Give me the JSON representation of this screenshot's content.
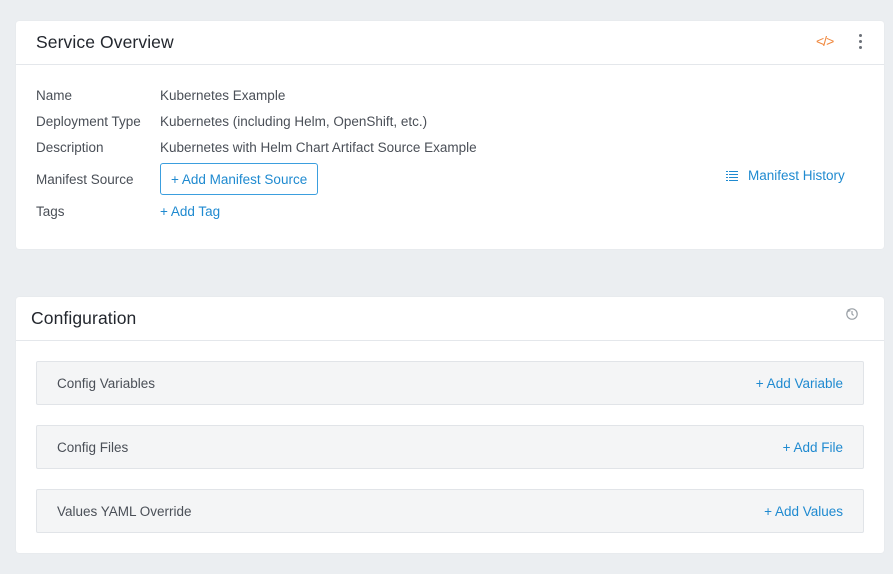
{
  "overview": {
    "title": "Service Overview",
    "code_icon": "</>",
    "rows": [
      {
        "label": "Name",
        "value": "Kubernetes Example"
      },
      {
        "label": "Deployment Type",
        "value": "Kubernetes (including Helm, OpenShift, etc.)"
      },
      {
        "label": "Description",
        "value": "Kubernetes with Helm Chart Artifact Source Example"
      },
      {
        "label": "Manifest Source",
        "button": "+ Add Manifest Source"
      },
      {
        "label": "Tags",
        "link": "+ Add Tag"
      }
    ],
    "manifest_history": "Manifest History"
  },
  "configuration": {
    "title": "Configuration",
    "sections": [
      {
        "title": "Config Variables",
        "action": "+ Add Variable"
      },
      {
        "title": "Config Files",
        "action": "+ Add File"
      },
      {
        "title": "Values YAML Override",
        "action": "+ Add Values"
      }
    ]
  },
  "colors": {
    "accent": "#1f8ad0",
    "code_icon": "#f0873c",
    "background": "#ebeef1"
  },
  "icons": [
    "code-icon",
    "kebab-menu-icon",
    "list-icon",
    "history-icon"
  ]
}
